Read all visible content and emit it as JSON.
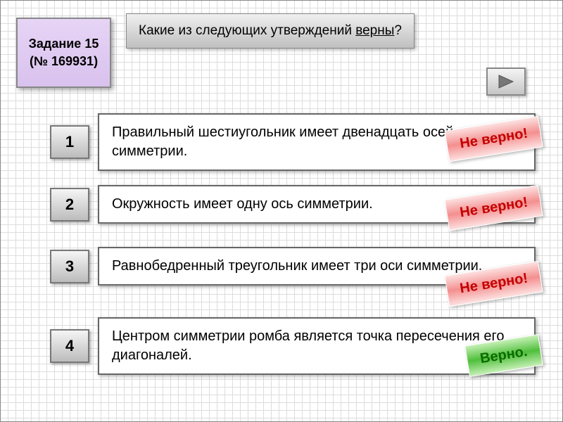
{
  "task": {
    "label_line1": "Задание 15",
    "label_line2": "(№ 169931)"
  },
  "question": {
    "prefix": "Какие из следующих утверждений ",
    "underlined": "верны",
    "suffix": "?"
  },
  "options": [
    {
      "num": "1",
      "text": "Правильный шестиугольник имеет двенадцать осей симметрии.",
      "badge": "Не верно!",
      "correct": false
    },
    {
      "num": "2",
      "text": "Окружность имеет одну ось симметрии.",
      "badge": "Не верно!",
      "correct": false
    },
    {
      "num": "3",
      "text": "Равнобедренный треугольник имеет три оси симметрии.",
      "badge": "Не верно!",
      "correct": false
    },
    {
      "num": "4",
      "text": "Центром симметрии ромба является точка пересечения его диагоналей.",
      "badge": "Верно.",
      "correct": true
    }
  ]
}
